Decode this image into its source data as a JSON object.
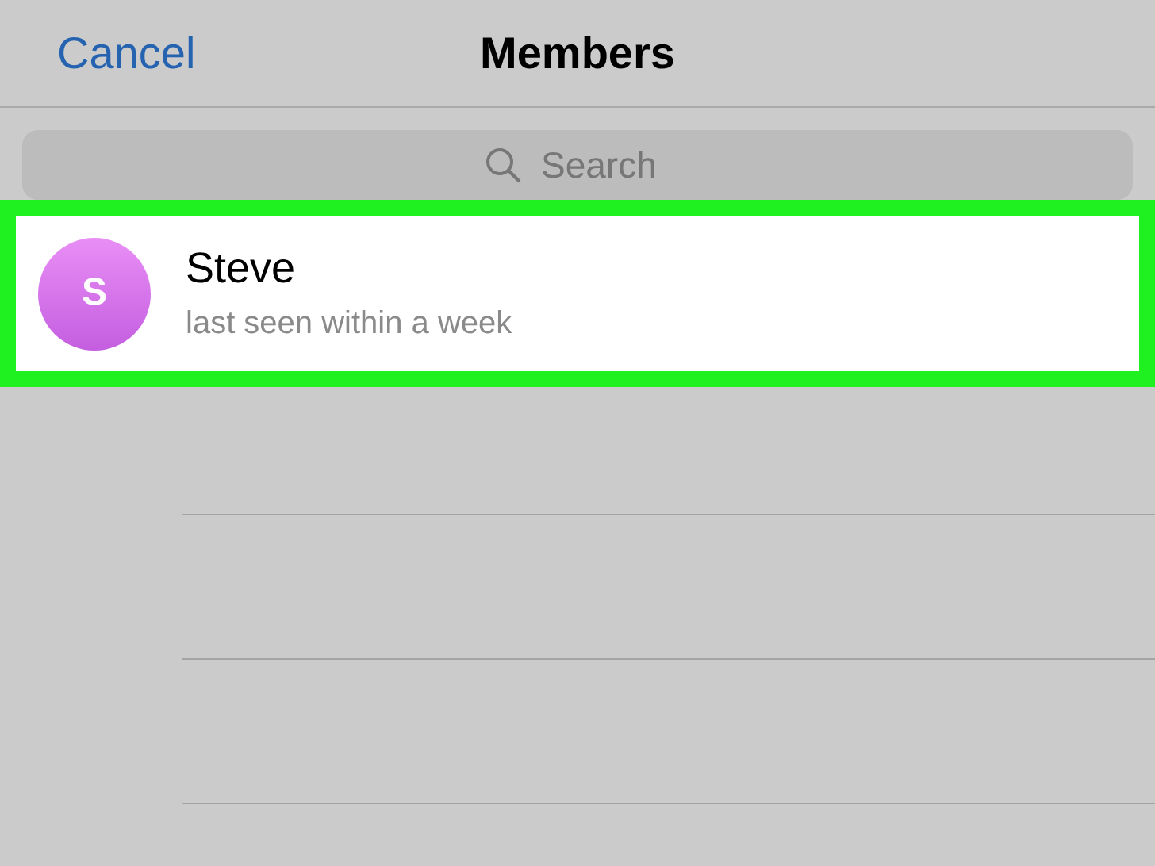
{
  "nav_bar": {
    "cancel": "Cancel",
    "title": "Members"
  },
  "search": {
    "placeholder": "Search"
  },
  "members": [
    {
      "initial": "S",
      "name": "Steve",
      "status": "last seen within a week",
      "highlighted": true
    }
  ]
}
